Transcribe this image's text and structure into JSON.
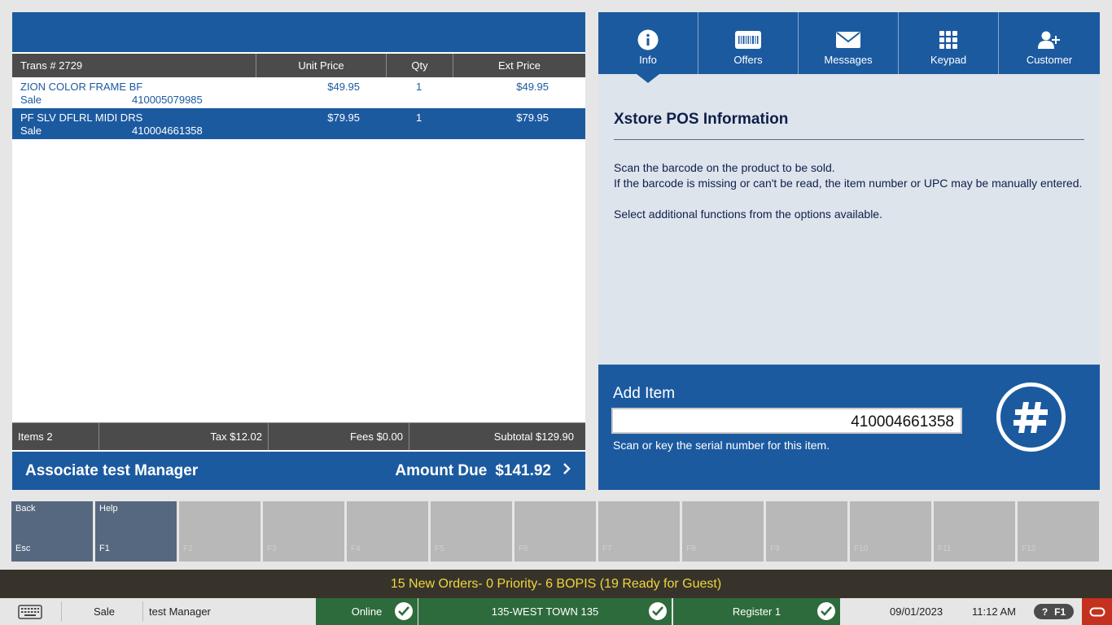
{
  "transaction": {
    "trans_label": "Trans #  2729",
    "col_unit_price": "Unit Price",
    "col_qty": "Qty",
    "col_ext_price": "Ext Price"
  },
  "items": [
    {
      "description": "ZION COLOR FRAME BF",
      "type": "Sale",
      "sku": "410005079985",
      "unit_price": "$49.95",
      "qty": "1",
      "ext_price": "$49.95",
      "selected": false
    },
    {
      "description": "PF SLV DFLRL MIDI DRS",
      "type": "Sale",
      "sku": "410004661358",
      "unit_price": "$79.95",
      "qty": "1",
      "ext_price": "$79.95",
      "selected": true
    }
  ],
  "totals": {
    "items": "Items 2",
    "tax": "Tax $12.02",
    "fees": "Fees $0.00",
    "subtotal": "Subtotal $129.90"
  },
  "summary": {
    "associate": "Associate test Manager",
    "amount_due_label": "Amount Due",
    "amount_due_value": "$141.92"
  },
  "tabs": [
    {
      "label": "Info",
      "icon": "info-icon",
      "active": true
    },
    {
      "label": "Offers",
      "icon": "barcode-icon",
      "active": false
    },
    {
      "label": "Messages",
      "icon": "envelope-icon",
      "active": false
    },
    {
      "label": "Keypad",
      "icon": "keypad-icon",
      "active": false
    },
    {
      "label": "Customer",
      "icon": "add-user-icon",
      "active": false
    }
  ],
  "info": {
    "title": "Xstore POS Information",
    "line1": "Scan the barcode on the product to be sold.",
    "line2": "If the barcode is missing or can't be read, the item number or UPC may be manually entered.",
    "line3": "Select additional functions from the options available."
  },
  "add_item": {
    "label": "Add Item",
    "value": "410004661358",
    "hint": "Scan or key the serial number for this item."
  },
  "fkeys": [
    {
      "label": "Back",
      "key": "Esc",
      "active": true
    },
    {
      "label": "Help",
      "key": "F1",
      "active": true
    },
    {
      "label": "",
      "key": "F2",
      "active": false
    },
    {
      "label": "",
      "key": "F3",
      "active": false
    },
    {
      "label": "",
      "key": "F4",
      "active": false
    },
    {
      "label": "",
      "key": "F5",
      "active": false
    },
    {
      "label": "",
      "key": "F6",
      "active": false
    },
    {
      "label": "",
      "key": "F7",
      "active": false
    },
    {
      "label": "",
      "key": "F8",
      "active": false
    },
    {
      "label": "",
      "key": "F9",
      "active": false
    },
    {
      "label": "",
      "key": "F10",
      "active": false
    },
    {
      "label": "",
      "key": "F11",
      "active": false
    },
    {
      "label": "",
      "key": "F12",
      "active": false
    }
  ],
  "orders_banner": "15 New Orders- 0 Priority- 6 BOPIS (19 Ready for Guest)",
  "status": {
    "mode": "Sale",
    "user": "test Manager",
    "online": "Online",
    "store": "135-WEST TOWN 135",
    "register": "Register 1",
    "date": "09/01/2023",
    "time": "11:12 AM",
    "help_q": "?",
    "help_key": "F1"
  },
  "colors": {
    "brand_blue": "#1c5aa0",
    "status_green": "#2e6b3c",
    "banner_text": "#f0d63e",
    "oracle_red": "#c5311f"
  }
}
